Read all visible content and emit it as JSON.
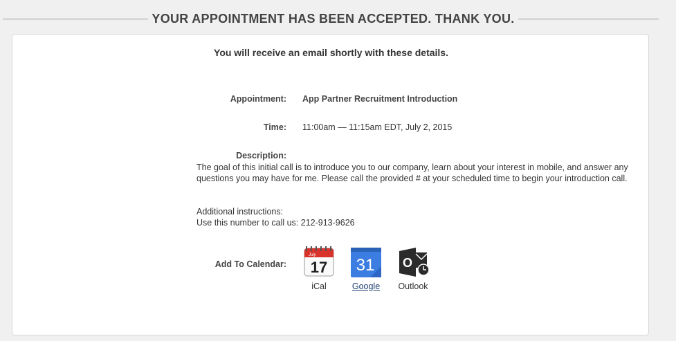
{
  "header": {
    "title": "YOUR APPOINTMENT HAS BEEN ACCEPTED. THANK YOU."
  },
  "notice": "You will receive an email shortly with these details.",
  "appointment": {
    "label": "Appointment:",
    "value": "App Partner Recruitment Introduction"
  },
  "time": {
    "label": "Time:",
    "value": "11:00am — 11:15am EDT, July 2, 2015"
  },
  "description": {
    "label": "Description:",
    "text": "The goal of this initial call is to introduce you to our company, learn about your interest in mobile, and answer any questions you may have for me. Please call the provided # at your scheduled time to begin your introduction call."
  },
  "additional": {
    "heading": "Additional instructions:",
    "text": "Use this number to call us: 212-913-9626"
  },
  "calendar": {
    "label": "Add To Calendar:",
    "ical": {
      "caption": "iCal",
      "icon": "ical-icon",
      "month": "July",
      "day": "17"
    },
    "google": {
      "caption": "Google",
      "icon": "google-calendar-icon",
      "day": "31"
    },
    "outlook": {
      "caption": "Outlook",
      "icon": "outlook-icon",
      "letter": "O"
    }
  },
  "colors": {
    "page_bg": "#f0f0f0",
    "google_blue": "#3b7de0",
    "link": "#1a3d6e",
    "ical_red": "#d9312b"
  }
}
